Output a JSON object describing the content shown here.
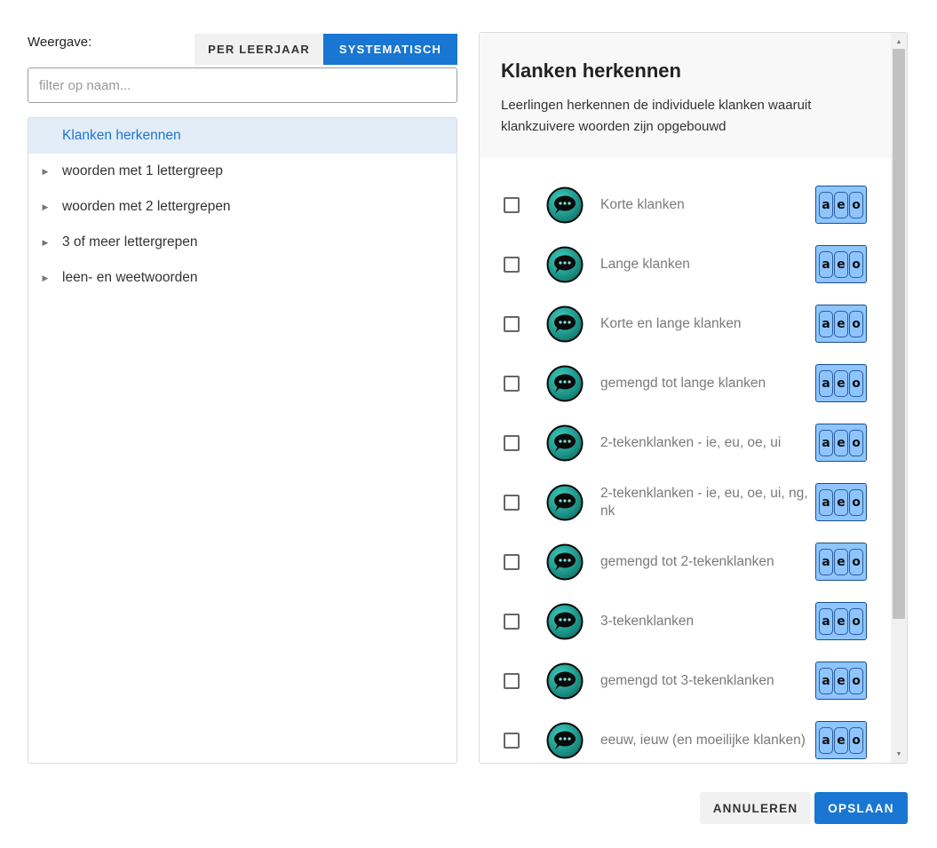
{
  "view": {
    "label": "Weergave:",
    "toggle": [
      "PER LEERJAAR",
      "SYSTEMATISCH"
    ],
    "active_index": 1
  },
  "filter": {
    "placeholder": "filter op naam..."
  },
  "tree": [
    {
      "label": "Klanken herkennen",
      "selected": true,
      "expandable": false
    },
    {
      "label": "woorden met 1 lettergreep",
      "selected": false,
      "expandable": true
    },
    {
      "label": "woorden met 2 lettergrepen",
      "selected": false,
      "expandable": true
    },
    {
      "label": "3 of meer lettergrepen",
      "selected": false,
      "expandable": true
    },
    {
      "label": "leen- en weetwoorden",
      "selected": false,
      "expandable": true
    }
  ],
  "panel": {
    "title": "Klanken herkennen",
    "description": "Leerlingen herkennen de individuele klanken waaruit klankzuivere woorden zijn opgebouwd",
    "aeo_letters": [
      "a",
      "e",
      "o"
    ],
    "items": [
      {
        "label": "Korte klanken",
        "checked": false
      },
      {
        "label": "Lange klanken",
        "checked": false
      },
      {
        "label": "Korte en lange klanken",
        "checked": false
      },
      {
        "label": "gemengd tot lange klanken",
        "checked": false
      },
      {
        "label": "2-tekenklanken - ie, eu, oe, ui",
        "checked": false
      },
      {
        "label": "2-tekenklanken - ie, eu, oe, ui, ng, nk",
        "checked": false
      },
      {
        "label": "gemengd tot 2-tekenklanken",
        "checked": false
      },
      {
        "label": "3-tekenklanken",
        "checked": false
      },
      {
        "label": "gemengd tot 3-tekenklanken",
        "checked": false
      },
      {
        "label": "eeuw, ieuw (en moeilijke klanken)",
        "checked": false
      }
    ]
  },
  "footer": {
    "cancel_label": "ANNULEREN",
    "save_label": "OPSLAAN"
  },
  "colors": {
    "accent": "#1976d2",
    "selected_bg": "#e3edf8",
    "aeo_bg": "#8ec5ff",
    "speech_bubble": "#1fa89a"
  },
  "icons": {
    "speech": "speech-bubble-icon",
    "letters": "aeo-letters-icon",
    "expand": "triangle-right-icon"
  }
}
